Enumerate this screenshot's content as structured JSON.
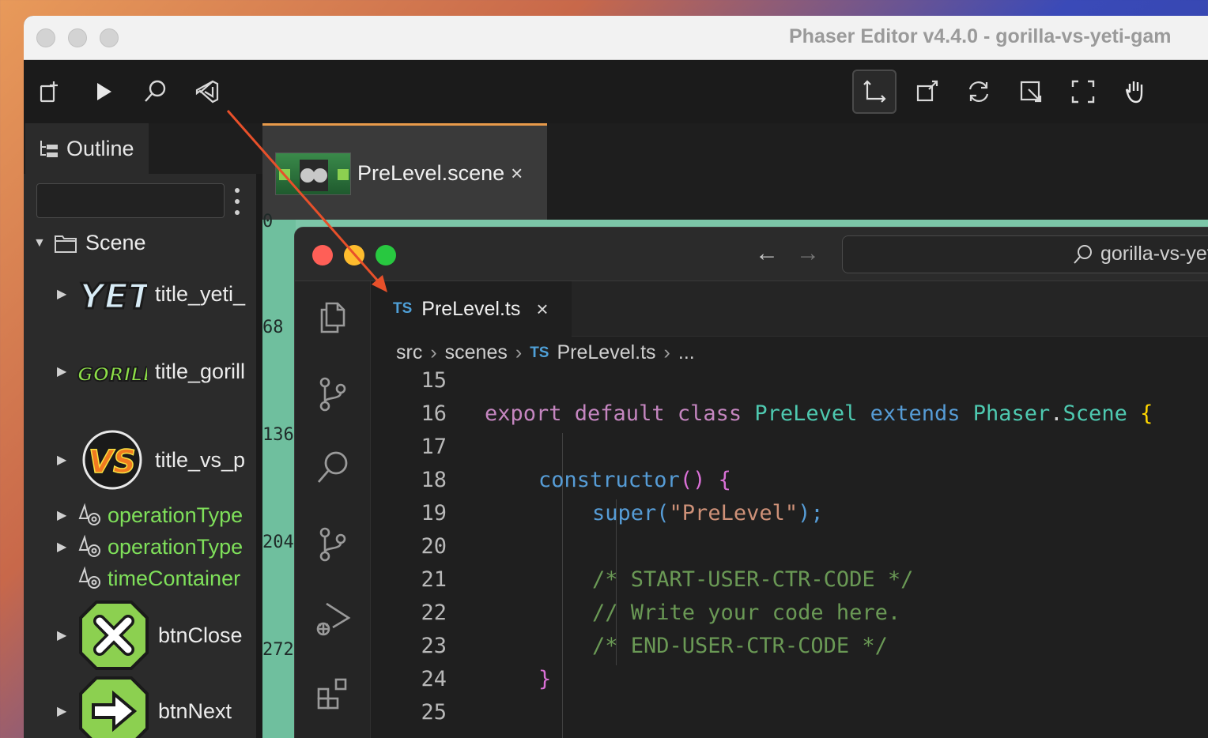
{
  "window": {
    "title": "Phaser Editor v4.4.0 - gorilla-vs-yeti-gam"
  },
  "outline": {
    "tab_label": "Outline",
    "filter_value": "",
    "root_label": "Scene",
    "items": [
      {
        "label": "title_yeti_",
        "thumb": "YETI"
      },
      {
        "label": "title_gorill",
        "thumb": "GORILLA"
      },
      {
        "label": "title_vs_p",
        "thumb": "VS"
      },
      {
        "label": "operationType",
        "thumb": ""
      },
      {
        "label": "operationType",
        "thumb": ""
      },
      {
        "label": "timeContainer",
        "thumb": ""
      },
      {
        "label": "btnClose",
        "thumb": ""
      },
      {
        "label": "btnNext",
        "thumb": ""
      }
    ]
  },
  "scene_tab": {
    "label": "PreLevel.scene",
    "close": "×"
  },
  "ruler": [
    "0",
    "68",
    "136",
    "204",
    "272"
  ],
  "vscode": {
    "search_text": "gorilla-vs-yeti-",
    "tab": {
      "badge": "TS",
      "label": "PreLevel.ts",
      "close": "×"
    },
    "breadcrumb": {
      "seg1": "src",
      "seg2": "scenes",
      "badge": "TS",
      "seg3": "PreLevel.ts",
      "seg4": "..."
    },
    "line_numbers": [
      "15",
      "16",
      "17",
      "18",
      "19",
      "20",
      "21",
      "22",
      "23",
      "24",
      "25"
    ],
    "code": {
      "l16a": "export default class ",
      "l16b": "PreLevel",
      "l16c": " extends ",
      "l16d": "Phaser",
      "l16e": ".",
      "l16f": "Scene",
      "l16g": " {",
      "l18a": "constructor",
      "l18b": "() {",
      "l19a": "super",
      "l19b": "(",
      "l19c": "\"PreLevel\"",
      "l19d": ");",
      "l21": "/* START-USER-CTR-CODE */",
      "l22": "// Write your code here.",
      "l23": "/* END-USER-CTR-CODE */",
      "l24": "}"
    }
  },
  "colors": {
    "accent_tab": "#e89a4a",
    "arrow": "#e8502a",
    "close_dot": "#ff5f57",
    "min_dot": "#febc2e",
    "max_dot": "#28c840"
  }
}
